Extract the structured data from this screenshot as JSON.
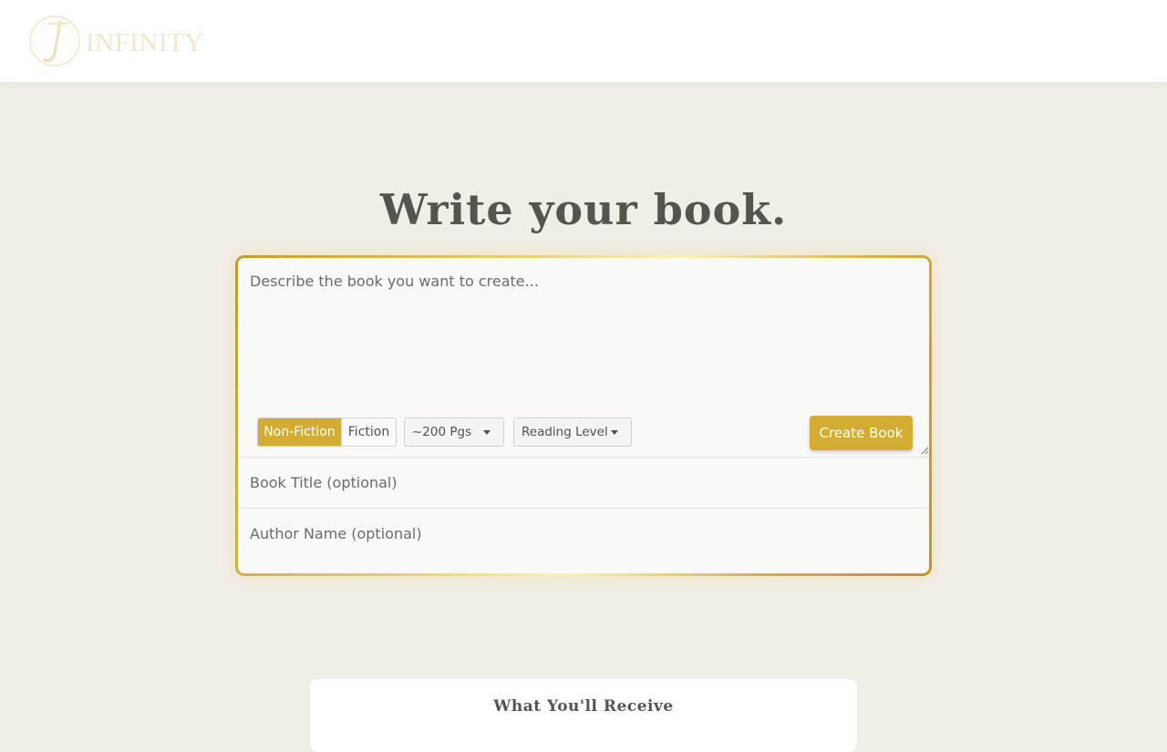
{
  "brand": {
    "logo_text": "INFINITY",
    "logo_icon": "monogram-j-icon"
  },
  "main": {
    "heading": "Write your book."
  },
  "form": {
    "prompt_placeholder": "Describe the book you want to create...",
    "genre_options": [
      "Non-Fiction",
      "Fiction"
    ],
    "genre_selected": "Non-Fiction",
    "length_value": "~200 Pgs",
    "reading_level_value": "Reading Level",
    "create_label": "Create Book",
    "title_placeholder": "Book Title (optional)",
    "author_placeholder": "Author Name (optional)"
  },
  "receive": {
    "title": "What You'll Receive"
  },
  "colors": {
    "accent_gold": "#d2ac33",
    "background": "#f1eee8",
    "heading_text": "#565350"
  }
}
